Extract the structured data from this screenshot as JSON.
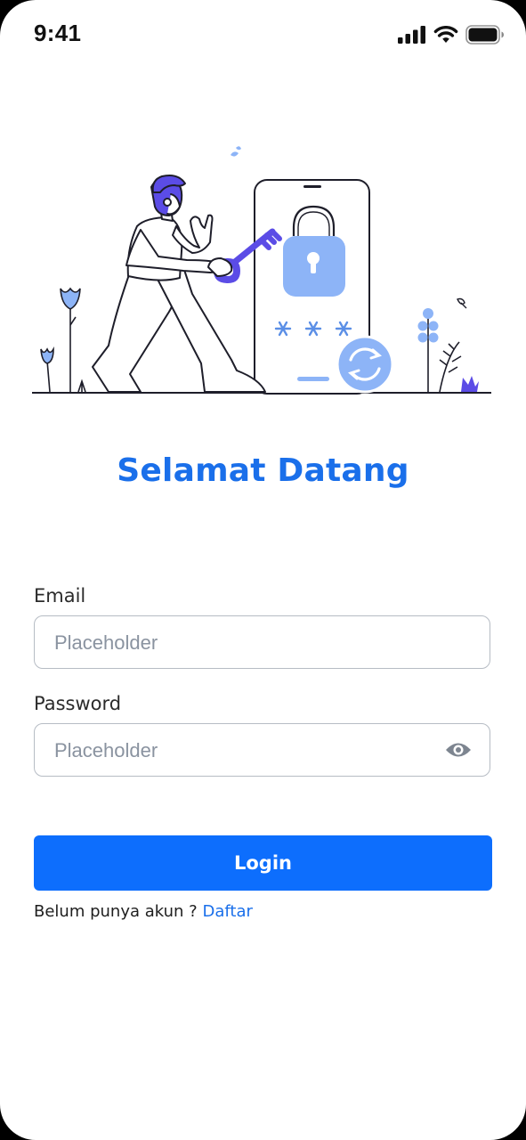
{
  "status_bar": {
    "time": "9:41",
    "icons": [
      "cellular-signal-icon",
      "wifi-icon",
      "battery-icon"
    ]
  },
  "illustration": {
    "name": "login-security-illustration",
    "accent_colors": [
      "#5B4CE6",
      "#8DB4F7",
      "#1E1E2A"
    ]
  },
  "title": "Selamat Datang",
  "form": {
    "email": {
      "label": "Email",
      "value": "",
      "placeholder": "Placeholder"
    },
    "password": {
      "label": "Password",
      "value": "",
      "placeholder": "Placeholder",
      "toggle_icon": "eye-icon"
    },
    "login_label": "Login"
  },
  "register": {
    "prompt": "Belum punya akun ?",
    "link_label": "Daftar"
  },
  "colors": {
    "primary": "#0D6EFD",
    "title": "#1A6FEA",
    "input_border": "#B6BCC4",
    "placeholder": "#8A93A0"
  }
}
